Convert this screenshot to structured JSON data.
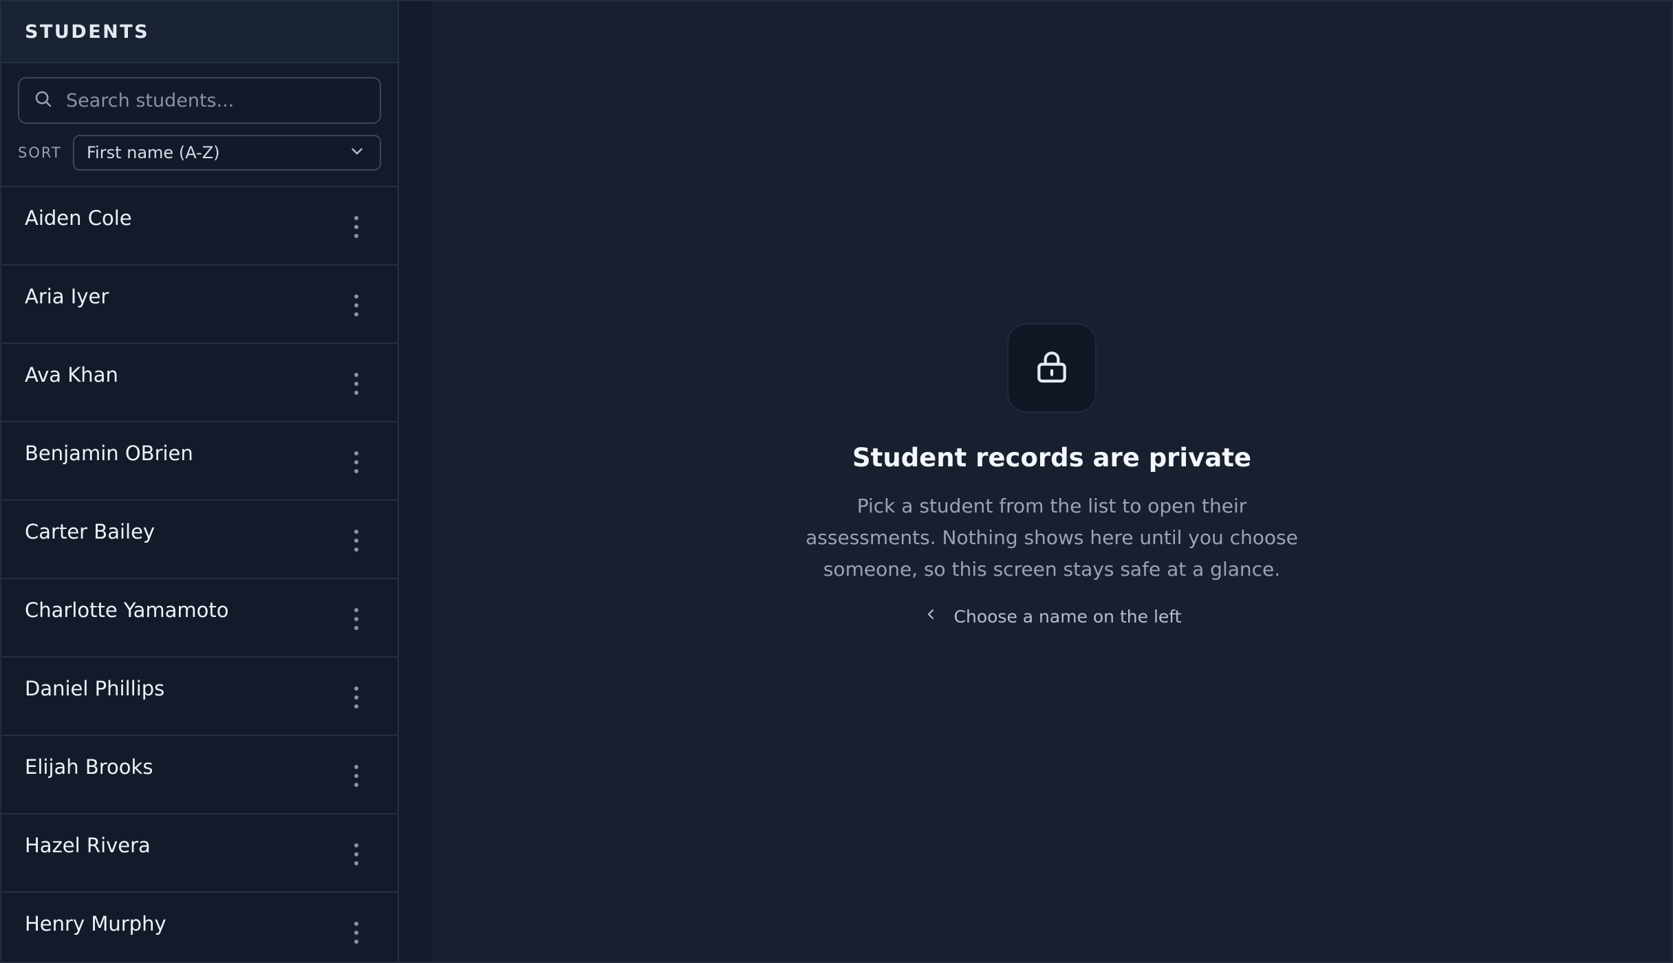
{
  "sidebar": {
    "title": "STUDENTS",
    "search": {
      "placeholder": "Search students...",
      "value": ""
    },
    "sort": {
      "label": "SORT",
      "selected": "First name (A-Z)"
    },
    "students": [
      {
        "name": "Aiden Cole"
      },
      {
        "name": "Aria Iyer"
      },
      {
        "name": "Ava Khan"
      },
      {
        "name": "Benjamin OBrien"
      },
      {
        "name": "Carter Bailey"
      },
      {
        "name": "Charlotte Yamamoto"
      },
      {
        "name": "Daniel Phillips"
      },
      {
        "name": "Elijah Brooks"
      },
      {
        "name": "Hazel Rivera"
      },
      {
        "name": "Henry Murphy"
      }
    ]
  },
  "main": {
    "icon": "lock-icon",
    "title": "Student records are private",
    "description": "Pick a student from the list to open their assessments. Nothing shows here until you choose someone, so this screen stays safe at a glance.",
    "hint": "Choose a name on the left"
  },
  "colors": {
    "background": "#182030",
    "sidebar": "#131b2b",
    "text_primary": "#eef2f7",
    "text_muted": "#9aa3b2"
  }
}
